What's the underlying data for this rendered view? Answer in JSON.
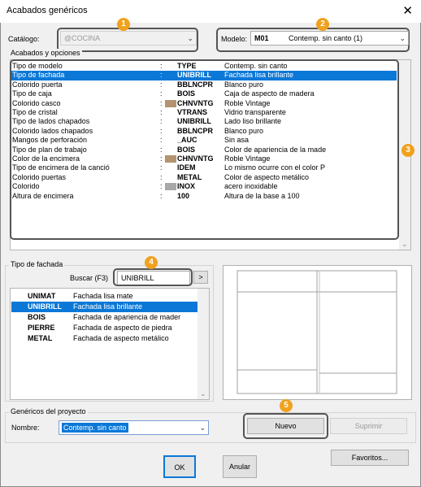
{
  "window": {
    "title": "Acabados genéricos"
  },
  "catalog": {
    "label": "Catálogo:",
    "value": "@COCINA"
  },
  "model": {
    "label": "Modelo:",
    "code": "M01",
    "name": "Contemp. sin canto (1)"
  },
  "options": {
    "group_label": "Acabados y opciones",
    "rows": [
      {
        "name": "Tipo de modelo",
        "sep": ":",
        "code": "TYPE",
        "desc": "Contemp. sin canto"
      },
      {
        "name": "Tipo de fachada",
        "sep": ":",
        "code": "UNIBRILL",
        "desc": "Fachada lisa brillante"
      },
      {
        "name": "Colorido puerta",
        "sep": ":",
        "code": "BBLNCPR",
        "desc": "Blanco puro"
      },
      {
        "name": "Tipo de caja",
        "sep": ":",
        "code": "BOIS",
        "desc": "Caja de aspecto de madera"
      },
      {
        "name": "Colorido casco",
        "sep": ":",
        "code": "CHNVNTG",
        "desc": "Roble Vintage",
        "swatch": "#b39370"
      },
      {
        "name": "Tipo de cristal",
        "sep": ":",
        "code": "VTRANS",
        "desc": "Vidrio transparente"
      },
      {
        "name": "Tipo de lados chapados",
        "sep": ":",
        "code": "UNIBRILL",
        "desc": "Lado liso brillante"
      },
      {
        "name": "Colorido lados chapados",
        "sep": ":",
        "code": "BBLNCPR",
        "desc": "Blanco puro"
      },
      {
        "name": "Mangos de perforación",
        "sep": ":",
        "code": "_AUC",
        "desc": "Sin asa"
      },
      {
        "name": "Tipo de plan de trabajo",
        "sep": ":",
        "code": "BOIS",
        "desc": "Color de apariencia de la made"
      },
      {
        "name": "Color de la encimera",
        "sep": ":",
        "code": "CHNVNTG",
        "desc": "Roble Vintage",
        "swatch": "#b39370"
      },
      {
        "name": "Tipo de encimera de la canció",
        "sep": ":",
        "code": "IDEM",
        "desc": "Lo mismo ocurre con el color P"
      },
      {
        "name": "Colorido puertas",
        "sep": ":",
        "code": "METAL",
        "desc": "Color de aspecto metálico"
      },
      {
        "name": "Colorido",
        "sep": ":",
        "code": "INOX",
        "desc": "acero inoxidable",
        "swatch": "#a8a8a8"
      },
      {
        "name": "Altura de encimera",
        "sep": ":",
        "code": "100",
        "desc": "Altura de la base a 100"
      }
    ]
  },
  "facade": {
    "group_label": "Tipo de fachada",
    "search_label": "Buscar (F3)",
    "search_value": "UNIBRILL",
    "search_button": ">",
    "items": [
      {
        "code": "UNIMAT",
        "desc": "Fachada lisa mate"
      },
      {
        "code": "UNIBRILL",
        "desc": "Fachada lisa brillante"
      },
      {
        "code": "BOIS",
        "desc": "Fachada de apariencia de mader"
      },
      {
        "code": "PIERRE",
        "desc": "Fachada de aspecto de piedra"
      },
      {
        "code": "METAL",
        "desc": "Fachada de aspecto metálico"
      }
    ]
  },
  "project": {
    "group_label": "Genéricos del proyecto",
    "name_label": "Nombre:",
    "name_value": "Contemp. sin canto"
  },
  "buttons": {
    "nuevo": "Nuevo",
    "suprimir": "Suprimir",
    "ok": "OK",
    "anular": "Anular",
    "favoritos": "Favoritos..."
  },
  "badges": [
    "1",
    "2",
    "3",
    "4",
    "5"
  ],
  "colors": {
    "selection": "#0b78d7",
    "badge": "#f0a11e"
  }
}
